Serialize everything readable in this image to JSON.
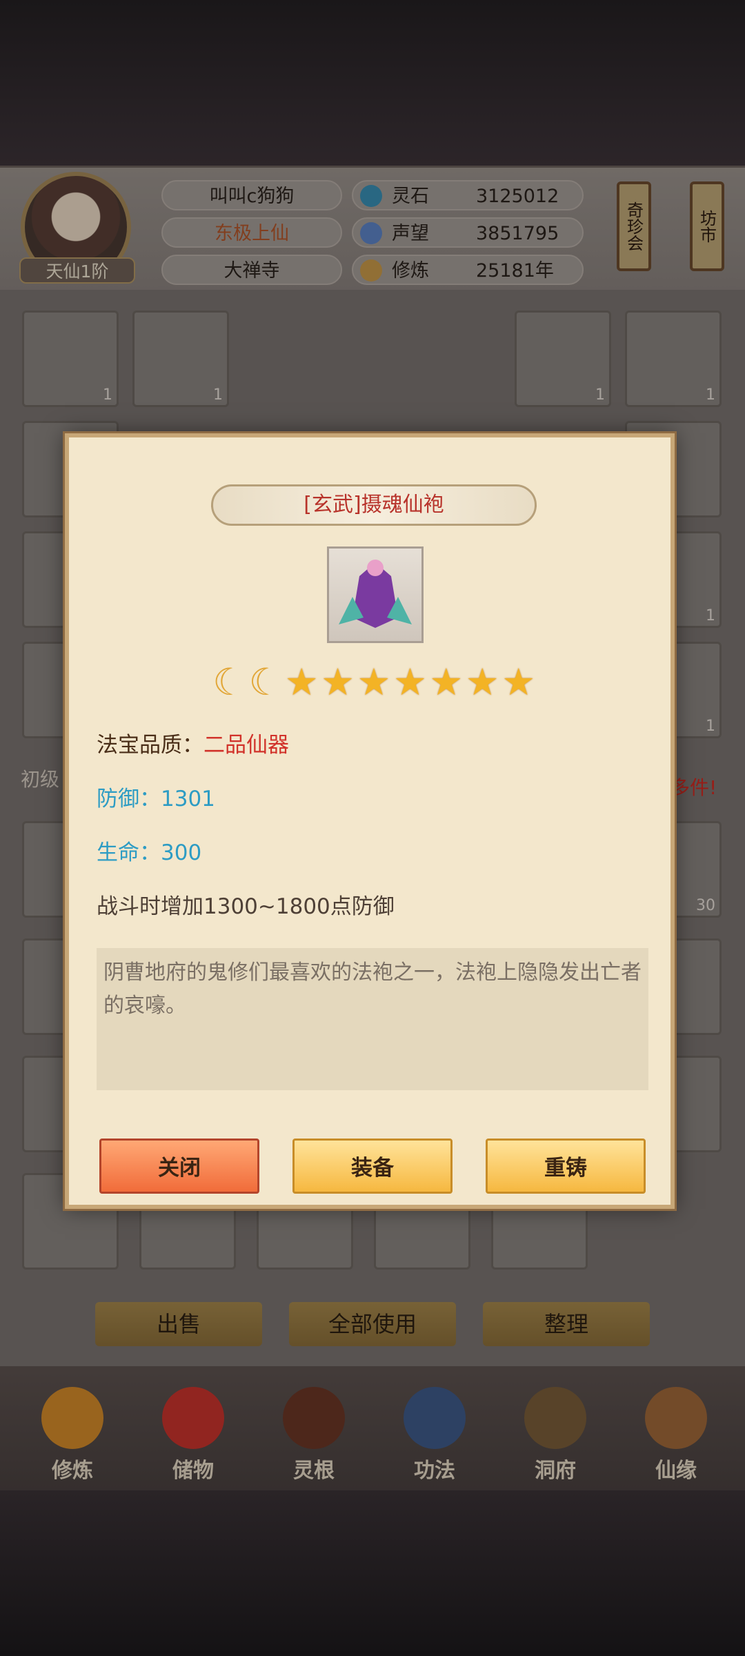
{
  "player": {
    "name": "叫叫c狗狗",
    "title": "东极上仙",
    "sect": "大禅寺",
    "rank": "天仙1阶"
  },
  "stats": [
    {
      "label": "灵石",
      "value": "3125012",
      "icon": "spirit-stone-icon"
    },
    {
      "label": "声望",
      "value": "3851795",
      "icon": "prestige-icon"
    },
    {
      "label": "修炼",
      "value": "25181年",
      "icon": "cultivation-icon"
    }
  ],
  "lanterns": [
    "奇珍会",
    "坊市"
  ],
  "grid_counts": {
    "c1": "1",
    "c2": "1",
    "c3": "1",
    "c4": "1",
    "c5": "1",
    "c6": "1",
    "c7": "30"
  },
  "side_text": {
    "left": "初级",
    "right": "多件!"
  },
  "bottom_buttons": [
    "出售",
    "全部使用",
    "整理"
  ],
  "nav": [
    "修炼",
    "储物",
    "灵根",
    "功法",
    "洞府",
    "仙缘"
  ],
  "item": {
    "title": "[玄武]摄魂仙袍",
    "moons": 2,
    "stars": 7,
    "quality_label": "法宝品质：",
    "quality_value": "二品仙器",
    "defense": "防御：1301",
    "life": "生命：300",
    "effect": "战斗时增加1300~1800点防御",
    "description": "阴曹地府的鬼修们最喜欢的法袍之一，法袍上隐隐发出亡者的哀嚎。"
  },
  "modal_buttons": {
    "close": "关闭",
    "equip": "装备",
    "recast": "重铸"
  },
  "colors": {
    "quality": "#d1322a",
    "attribute": "#2d9cc4",
    "title": "#b8332b"
  }
}
